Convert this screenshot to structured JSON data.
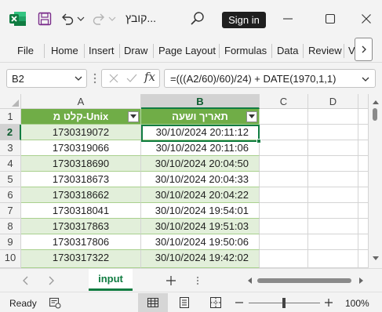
{
  "titlebar": {
    "doc_title": "קובץ...",
    "signin_label": "Sign in"
  },
  "ribbon": {
    "tabs": [
      "File",
      "Home",
      "Insert",
      "Draw",
      "Page Layout",
      "Formulas",
      "Data",
      "Review",
      "V"
    ]
  },
  "formula_bar": {
    "name_box": "B2",
    "fx_label": "fx",
    "formula": "=(((A2/60)/60)/24) + DATE(1970,1,1)"
  },
  "grid": {
    "columns": [
      "A",
      "B",
      "C",
      "D"
    ],
    "rows": [
      "1",
      "2",
      "3",
      "4",
      "5",
      "6",
      "7",
      "8",
      "9",
      "10"
    ],
    "header_row": [
      "קלט מ-Unix",
      "תאריך ושעה"
    ],
    "data_rows": [
      {
        "a": "1730319072",
        "b": "30/10/2024 20:11:12"
      },
      {
        "a": "1730319066",
        "b": "30/10/2024 20:11:06"
      },
      {
        "a": "1730318690",
        "b": "30/10/2024 20:04:50"
      },
      {
        "a": "1730318673",
        "b": "30/10/2024 20:04:33"
      },
      {
        "a": "1730318662",
        "b": "30/10/2024 20:04:22"
      },
      {
        "a": "1730318041",
        "b": "30/10/2024 19:54:01"
      },
      {
        "a": "1730317863",
        "b": "30/10/2024 19:51:03"
      },
      {
        "a": "1730317806",
        "b": "30/10/2024 19:50:06"
      },
      {
        "a": "1730317322",
        "b": "30/10/2024 19:42:02"
      }
    ]
  },
  "sheets": {
    "active": "input"
  },
  "status": {
    "ready": "Ready",
    "zoom": "100%"
  },
  "colors": {
    "accent": "#107c41",
    "table_header": "#70ad47",
    "table_band": "#e2efda"
  }
}
